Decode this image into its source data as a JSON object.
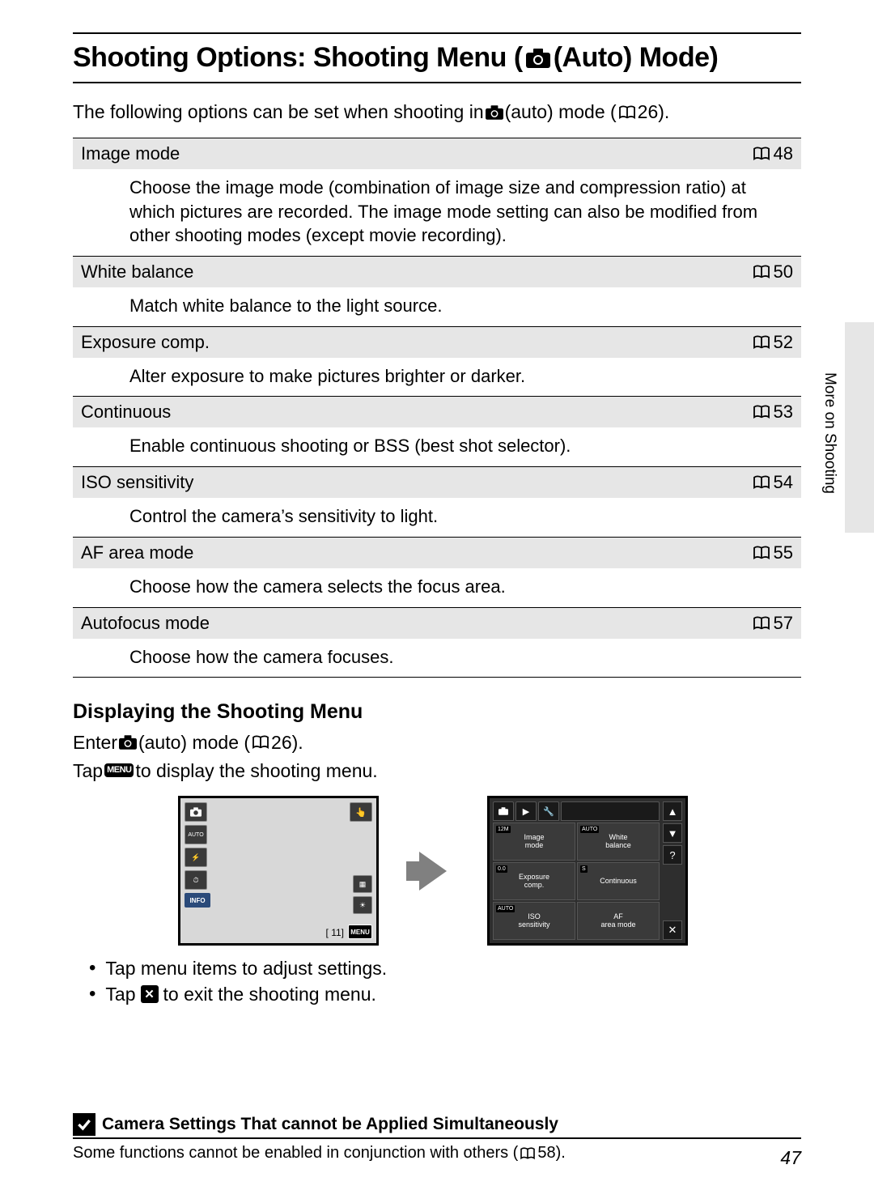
{
  "title": {
    "pre": "Shooting Options: Shooting Menu (",
    "post": " (Auto) Mode)"
  },
  "intro": {
    "a": "The following options can be set when shooting in ",
    "b": " (auto) mode (",
    "c": " 26)."
  },
  "options": [
    {
      "name": "Image mode",
      "page": "48",
      "desc": "Choose the image mode (combination of image size and compression ratio) at which pictures are recorded. The image mode setting can also be modified from other shooting modes (except movie recording)."
    },
    {
      "name": "White balance",
      "page": "50",
      "desc": "Match white balance to the light source."
    },
    {
      "name": "Exposure comp.",
      "page": "52",
      "desc": "Alter exposure to make pictures brighter or darker."
    },
    {
      "name": "Continuous",
      "page": "53",
      "desc": "Enable continuous shooting or BSS (best shot selector)."
    },
    {
      "name": "ISO sensitivity",
      "page": "54",
      "desc": "Control the camera’s sensitivity to light."
    },
    {
      "name": "AF area mode",
      "page": "55",
      "desc": "Choose how the camera selects the focus area."
    },
    {
      "name": "Autofocus mode",
      "page": "57",
      "desc": "Choose how the camera focuses."
    }
  ],
  "side_label": "More on Shooting",
  "sub_heading": "Displaying the Shooting Menu",
  "enter": {
    "a": "Enter ",
    "b": " (auto) mode (",
    "c": " 26)."
  },
  "tap_menu": {
    "a": "Tap ",
    "badge": "MENU",
    "b": " to display the shooting menu."
  },
  "screen1": {
    "sidebar_icons": [
      "camera",
      "auto",
      "flash-off",
      "timer-off"
    ],
    "info": "INFO",
    "menu": "MENU",
    "counter": "[   11]"
  },
  "screen2": {
    "cells": [
      {
        "mini": "12M",
        "label": "Image mode"
      },
      {
        "mini": "AUTO",
        "label": "White balance"
      },
      {
        "mini": "0.0",
        "label": "Exposure comp."
      },
      {
        "mini": "S",
        "label": "Continuous"
      },
      {
        "mini": "AUTO",
        "label": "ISO sensitivity"
      },
      {
        "mini": "",
        "label": "AF area mode"
      }
    ],
    "right": [
      "▲",
      "▼",
      "?",
      "✕"
    ]
  },
  "bullets": {
    "b1": "Tap menu items to adjust settings.",
    "b2a": "Tap ",
    "b2x": "✕",
    "b2b": " to exit the shooting menu."
  },
  "note": {
    "title": "Camera Settings That cannot be Applied Simultaneously",
    "body_a": "Some functions cannot be enabled in conjunction with others (",
    "body_b": " 58)."
  },
  "page_number": "47"
}
